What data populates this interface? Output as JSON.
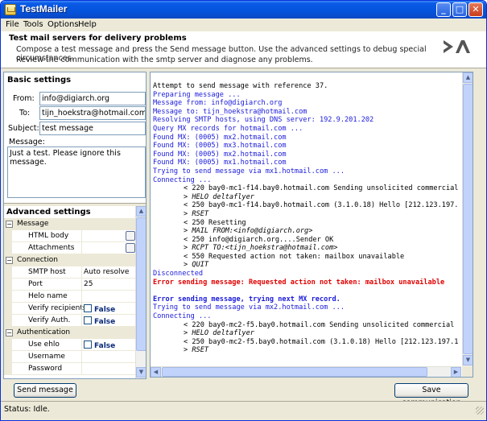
{
  "window": {
    "title": "TestMailer"
  },
  "menu": [
    "File",
    "Tools",
    "Options",
    "Help"
  ],
  "banner": {
    "title": "Test mail servers for delivery problems",
    "line1": "Compose a test message and press the Send message button. Use the advanced settings to debug special circumstances.",
    "line2": "Review the communication with the smtp server and diagnose any problems.",
    "logo": "DA"
  },
  "basic": {
    "title": "Basic settings",
    "from_label": "From:",
    "from_value": "info@digiarch.org",
    "to_label": "To:",
    "to_value": "tijn_hoekstra@hotmail.com",
    "subject_label": "Subject:",
    "subject_value": "test message",
    "message_label": "Message:",
    "message_value": "Just a test. Please ignore this message."
  },
  "advanced": {
    "title": "Advanced settings",
    "cat_message": "Message",
    "html_body": "HTML body",
    "attachments": "Attachments",
    "cat_connection": "Connection",
    "smtp_host": "SMTP host",
    "smtp_host_value": "Auto resolve",
    "port": "Port",
    "port_value": "25",
    "helo_name": "Helo name",
    "verify_recipients": "Verify recipients",
    "verify_auth": "Verify Auth.",
    "false_value": "False",
    "cat_authentication": "Authentication",
    "use_ehlo": "Use ehlo",
    "username": "Username",
    "password": "Password"
  },
  "log_lines": [
    {
      "c": "black",
      "t": "Attempt to send message with reference 37."
    },
    {
      "c": "blue",
      "t": "Preparing message ..."
    },
    {
      "c": "blue",
      "t": "Message from: info@digiarch.org"
    },
    {
      "c": "blue",
      "t": "Message to: tijn_hoekstra@hotmail.com"
    },
    {
      "c": "blue",
      "t": "Resolving SMTP hosts, using DNS server: 192.9.201.202"
    },
    {
      "c": "blue",
      "t": "Query MX records for hotmail.com ..."
    },
    {
      "c": "blue",
      "t": "Found MX: (0005) mx2.hotmail.com"
    },
    {
      "c": "blue",
      "t": "Found MX: (0005) mx3.hotmail.com"
    },
    {
      "c": "blue",
      "t": "Found MX: (0005) mx2.hotmail.com"
    },
    {
      "c": "blue",
      "t": "Found MX: (0005) mx1.hotmail.com"
    },
    {
      "c": "blue",
      "t": "Trying to send message via mx1.hotmail.com ..."
    },
    {
      "c": "blue",
      "t": "Connecting ..."
    },
    {
      "c": "indent",
      "t": "< 220 bay0-mc1-f14.bay0.hotmail.com Sending unsolicited commercial"
    },
    {
      "c": "italic",
      "t": "> HELO deltaflyer"
    },
    {
      "c": "indent",
      "t": "< 250 bay0-mc1-f14.bay0.hotmail.com (3.1.0.18) Hello [212.123.197."
    },
    {
      "c": "italic",
      "t": "> RSET"
    },
    {
      "c": "indent",
      "t": "< 250 Resetting"
    },
    {
      "c": "italic",
      "t": "> MAIL FROM:<info@digiarch.org>"
    },
    {
      "c": "indent",
      "t": "< 250 info@digiarch.org....Sender OK"
    },
    {
      "c": "italic",
      "t": "> RCPT TO:<tijn_hoekstra@hotmail.com>"
    },
    {
      "c": "indent",
      "t": "< 550 Requested action not taken: mailbox unavailable"
    },
    {
      "c": "italic",
      "t": "> QUIT"
    },
    {
      "c": "blue",
      "t": "Disconnected"
    },
    {
      "c": "red",
      "t": "Error sending message: Requested action not taken: mailbox unavailable"
    },
    {
      "c": "blank",
      "t": ""
    },
    {
      "c": "blueb",
      "t": "Error sending message, trying next MX record."
    },
    {
      "c": "blue",
      "t": "Trying to send message via mx2.hotmail.com ..."
    },
    {
      "c": "blue",
      "t": "Connecting ..."
    },
    {
      "c": "indent",
      "t": "< 220 bay0-mc2-f5.bay0.hotmail.com Sending unsolicited commercial"
    },
    {
      "c": "italic",
      "t": "> HELO deltaflyer"
    },
    {
      "c": "indent",
      "t": "< 250 bay0-mc2-f5.bay0.hotmail.com (3.1.0.18) Hello [212.123.197.1"
    },
    {
      "c": "italic",
      "t": "> RSET"
    }
  ],
  "buttons": {
    "send": "Send message",
    "save": "Save communication"
  },
  "status": "Status: Idle."
}
